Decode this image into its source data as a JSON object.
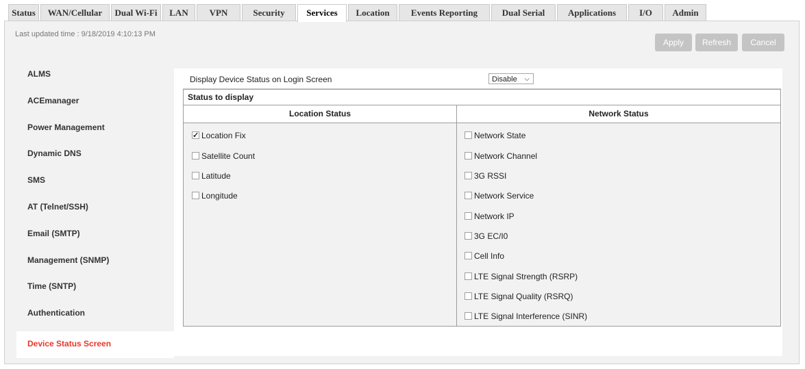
{
  "tabs": [
    {
      "label": "Status"
    },
    {
      "label": "WAN/Cellular"
    },
    {
      "label": "Dual Wi-Fi"
    },
    {
      "label": "LAN"
    },
    {
      "label": "VPN"
    },
    {
      "label": "Security"
    },
    {
      "label": "Services",
      "active": true
    },
    {
      "label": "Location"
    },
    {
      "label": "Events Reporting"
    },
    {
      "label": "Dual Serial"
    },
    {
      "label": "Applications"
    },
    {
      "label": "I/O"
    },
    {
      "label": "Admin"
    }
  ],
  "header": {
    "last_updated": "Last updated time : 9/18/2019 4:10:13 PM"
  },
  "toolbar": {
    "apply": "Apply",
    "refresh": "Refresh",
    "cancel": "Cancel"
  },
  "sidebar": {
    "items": [
      {
        "label": "ALMS"
      },
      {
        "label": "ACEmanager"
      },
      {
        "label": "Power Management"
      },
      {
        "label": "Dynamic DNS"
      },
      {
        "label": "SMS"
      },
      {
        "label": "AT (Telnet/SSH)"
      },
      {
        "label": "Email (SMTP)"
      },
      {
        "label": "Management (SNMP)"
      },
      {
        "label": "Time (SNTP)"
      },
      {
        "label": "Authentication"
      },
      {
        "label": "Device Status Screen",
        "active": true
      }
    ]
  },
  "settings": {
    "display_label": "Display Device Status on Login Screen",
    "display_value": "Disable"
  },
  "status_box": {
    "title": "Status to display",
    "location_header": "Location Status",
    "network_header": "Network Status",
    "location_items": [
      {
        "label": "Location Fix",
        "checked": true
      },
      {
        "label": "Satellite Count",
        "checked": false
      },
      {
        "label": "Latitude",
        "checked": false
      },
      {
        "label": "Longitude",
        "checked": false
      }
    ],
    "network_items": [
      {
        "label": "Network State",
        "checked": false
      },
      {
        "label": "Network Channel",
        "checked": false
      },
      {
        "label": "3G RSSI",
        "checked": false
      },
      {
        "label": "Network Service",
        "checked": false
      },
      {
        "label": "Network IP",
        "checked": false
      },
      {
        "label": "3G EC/I0",
        "checked": false
      },
      {
        "label": "Cell Info",
        "checked": false
      },
      {
        "label": "LTE Signal Strength (RSRP)",
        "checked": false
      },
      {
        "label": "LTE Signal Quality (RSRQ)",
        "checked": false
      },
      {
        "label": "LTE Signal Interference (SINR)",
        "checked": false
      }
    ]
  },
  "colors": {
    "accent": "#e8372b",
    "button": "#c4c4c4",
    "panel": "#f2f2f2"
  }
}
